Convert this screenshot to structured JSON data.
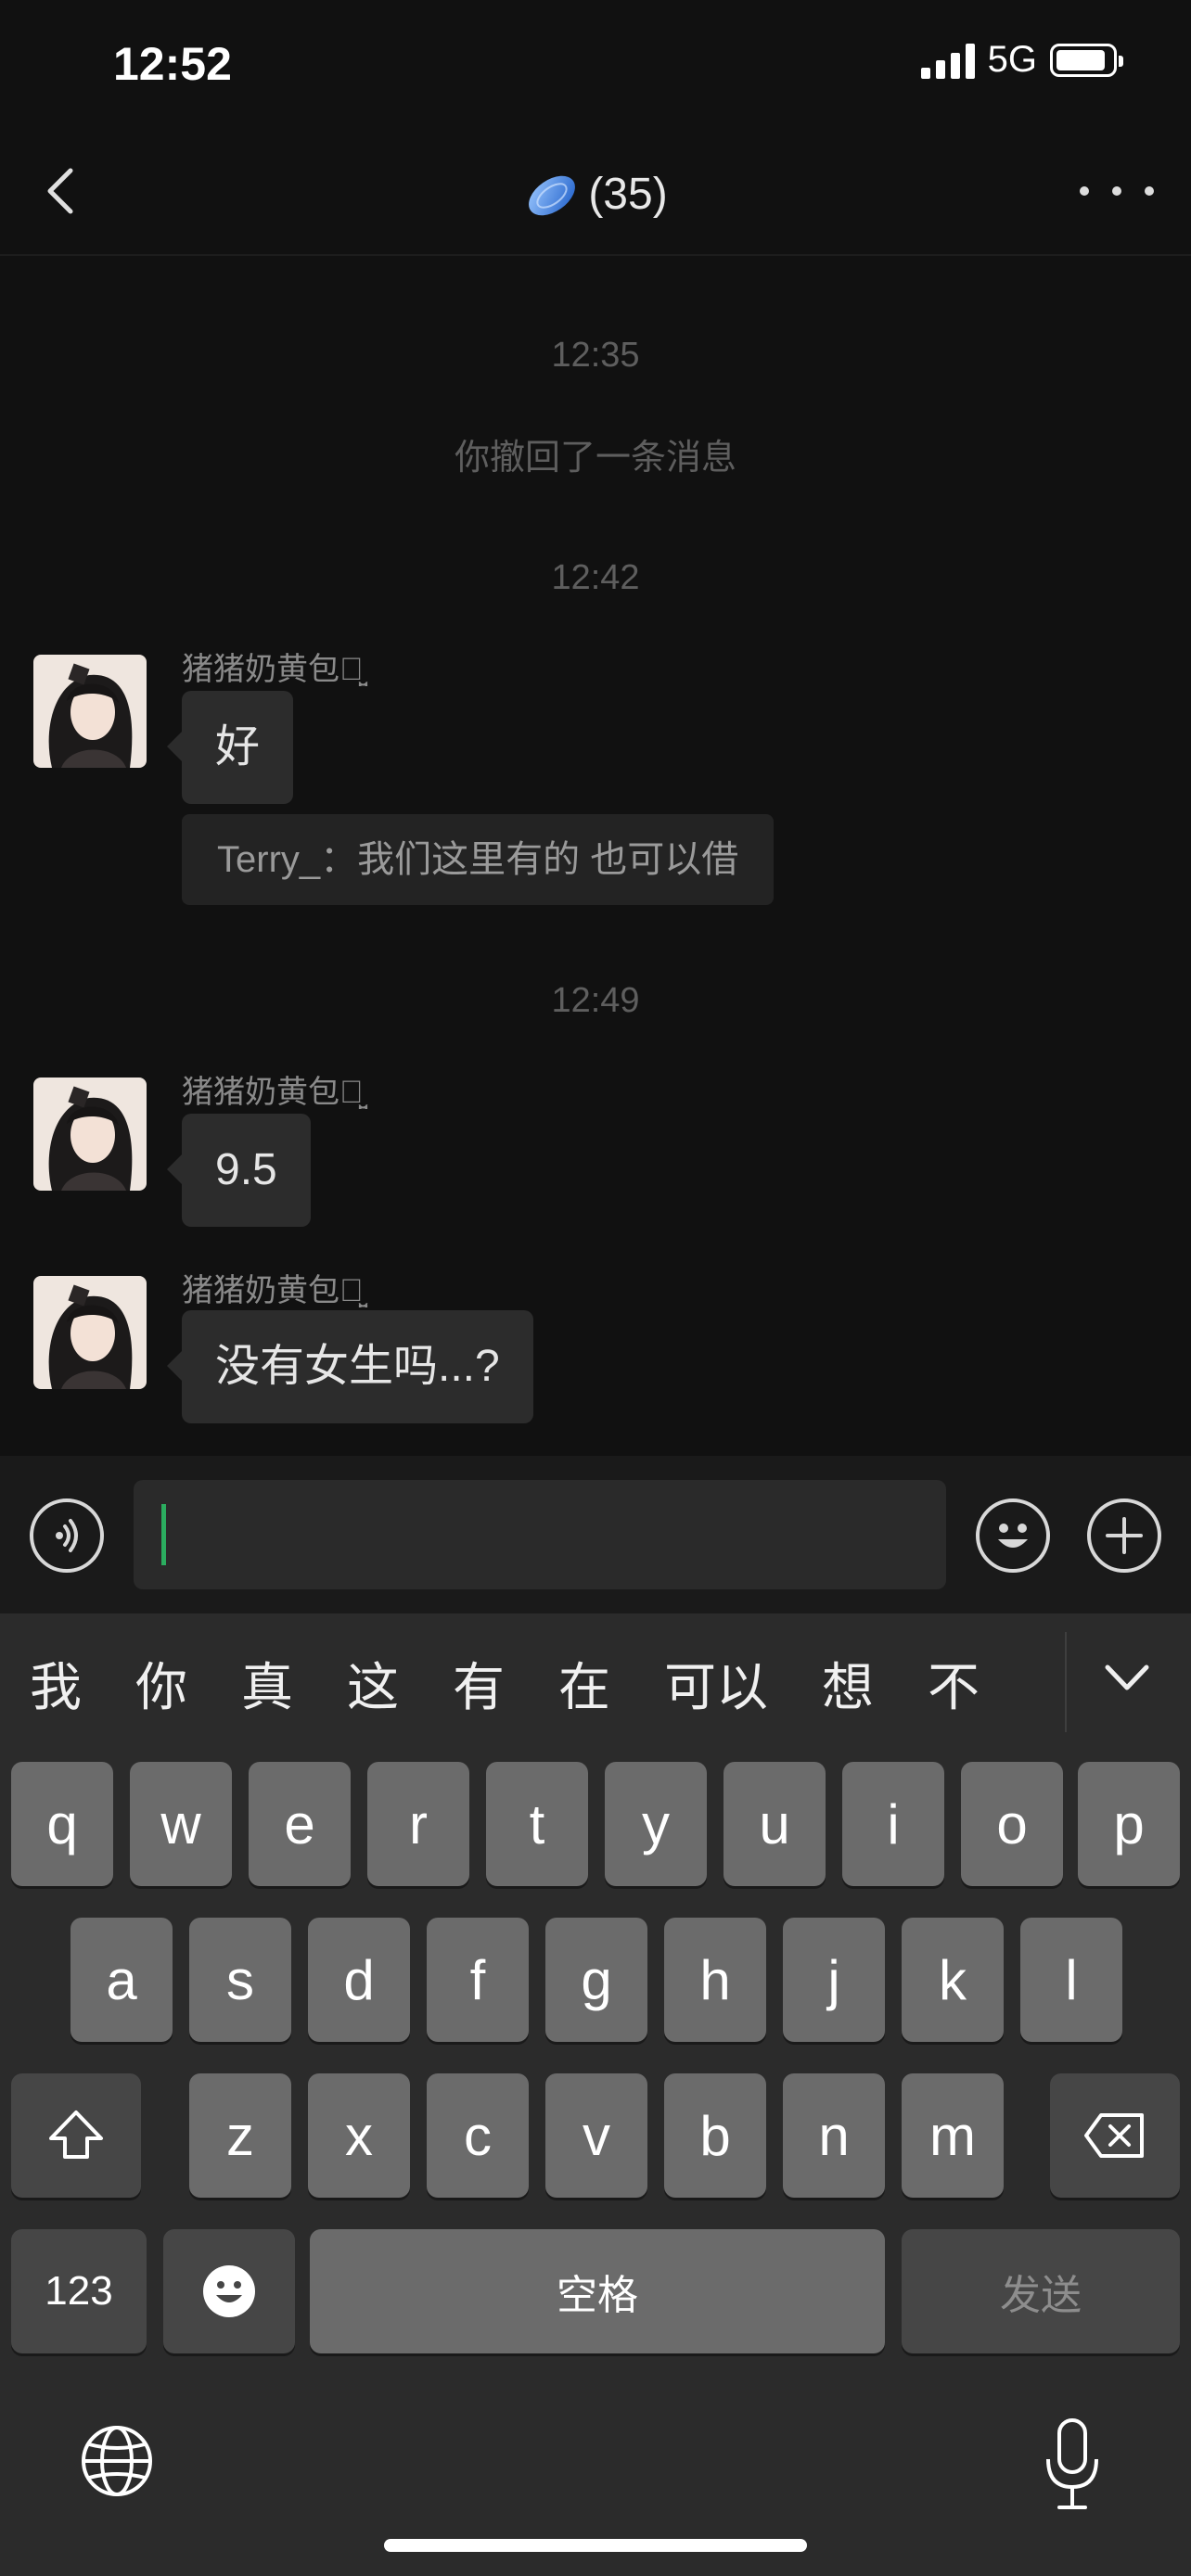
{
  "status_bar": {
    "time": "12:52",
    "network": "5G"
  },
  "header": {
    "title_count": "(35)",
    "title_icon": "blue-disc-emoji",
    "back_icon": "chevron-left-icon",
    "more_icon": "more-dots-icon"
  },
  "messages": [
    {
      "type": "time",
      "text": "12:35"
    },
    {
      "type": "system",
      "text": "你撤回了一条消息"
    },
    {
      "type": "time",
      "text": "12:42"
    },
    {
      "type": "message",
      "sender": "猪猪奶黄包ꪔ̤̮",
      "text": "好",
      "quote": "Terry_：我们这里有的 也可以借"
    },
    {
      "type": "time",
      "text": "12:49"
    },
    {
      "type": "message",
      "sender": "猪猪奶黄包ꪔ̤̮",
      "text": "9.5"
    },
    {
      "type": "message",
      "sender": "猪猪奶黄包ꪔ̤̮",
      "text": "没有女生吗...?"
    }
  ],
  "input": {
    "value": "",
    "placeholder": ""
  },
  "keyboard": {
    "candidates": [
      "我",
      "你",
      "真",
      "这",
      "有",
      "在",
      "可以",
      "想",
      "不"
    ],
    "row1": [
      "q",
      "w",
      "e",
      "r",
      "t",
      "y",
      "u",
      "i",
      "o",
      "p"
    ],
    "row2": [
      "a",
      "s",
      "d",
      "f",
      "g",
      "h",
      "j",
      "k",
      "l"
    ],
    "row3": [
      "z",
      "x",
      "c",
      "v",
      "b",
      "n",
      "m"
    ],
    "numbers_label": "123",
    "space_label": "空格",
    "send_label": "发送"
  },
  "colors": {
    "background": "#111111",
    "bubble": "#2c2c2c",
    "cursor": "#2bad5f",
    "key": "#6b6b6b",
    "key_dark": "#464646"
  }
}
